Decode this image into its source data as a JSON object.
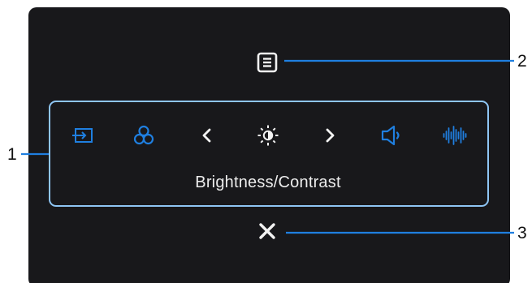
{
  "panel": {
    "label": "Brightness/Contrast",
    "icons": [
      "input-source-icon",
      "color-icon",
      "chevron-left-icon",
      "brightness-icon",
      "chevron-right-icon",
      "volume-icon",
      "audio-equalizer-icon"
    ]
  },
  "buttons": {
    "menu": "menu-icon",
    "close": "close-icon"
  },
  "callouts": [
    "1",
    "2",
    "3"
  ],
  "colors": {
    "screen_bg": "#18181b",
    "accent_blue": "#1f7fe0",
    "panel_border": "#8ec5f4",
    "icon_white": "#f2f2f2"
  }
}
